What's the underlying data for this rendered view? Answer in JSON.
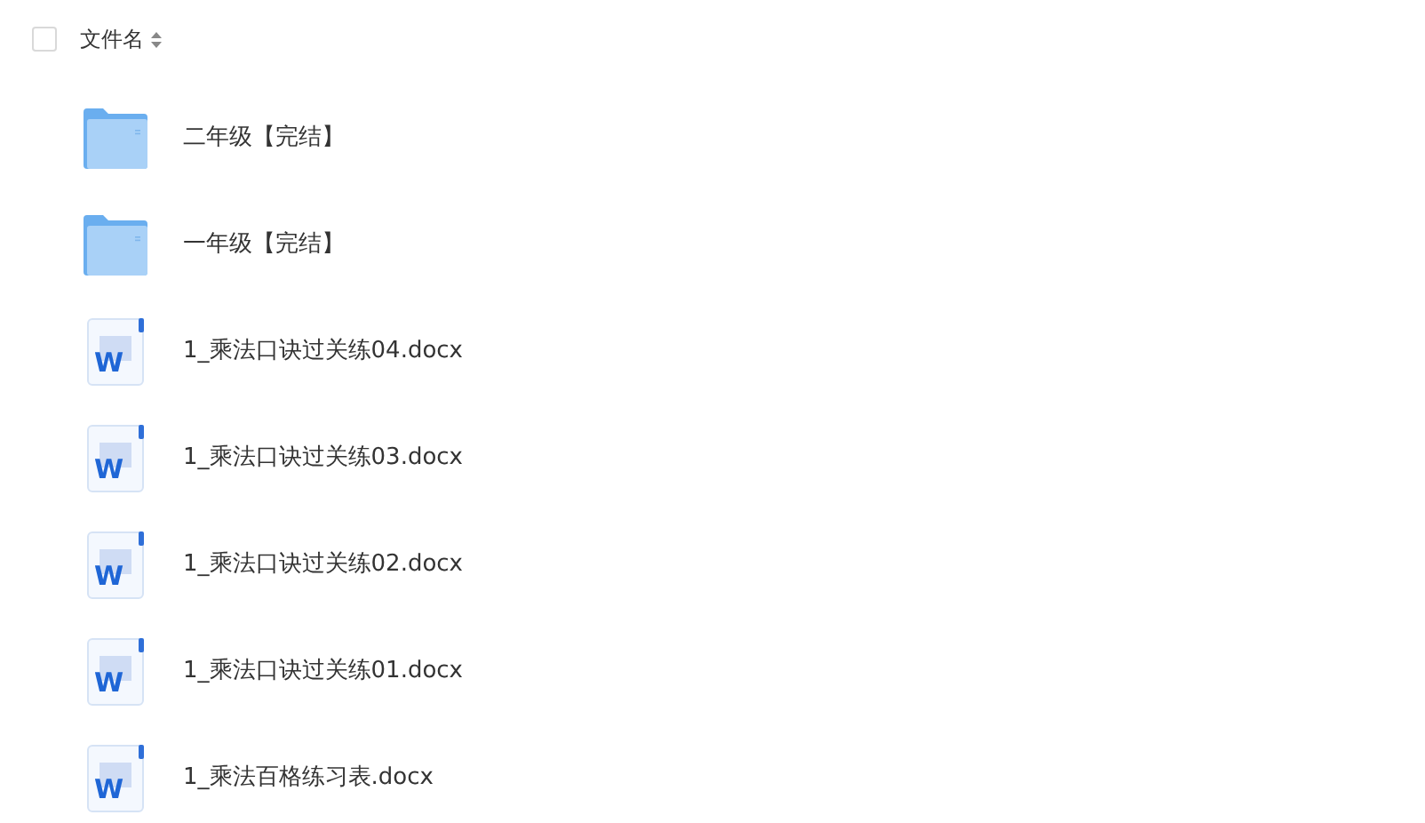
{
  "header": {
    "checked": false,
    "column": "文件名"
  },
  "files": [
    {
      "kind": "folder",
      "name": "二年级【完结】"
    },
    {
      "kind": "folder",
      "name": "一年级【完结】"
    },
    {
      "kind": "word",
      "badge": "W",
      "name": "1_乘法口诀过关练04.docx"
    },
    {
      "kind": "word",
      "badge": "W",
      "name": "1_乘法口诀过关练03.docx"
    },
    {
      "kind": "word",
      "badge": "W",
      "name": "1_乘法口诀过关练02.docx"
    },
    {
      "kind": "word",
      "badge": "W",
      "name": "1_乘法口诀过关练01.docx"
    },
    {
      "kind": "word",
      "badge": "W",
      "name": "1_乘法百格练习表.docx"
    }
  ]
}
